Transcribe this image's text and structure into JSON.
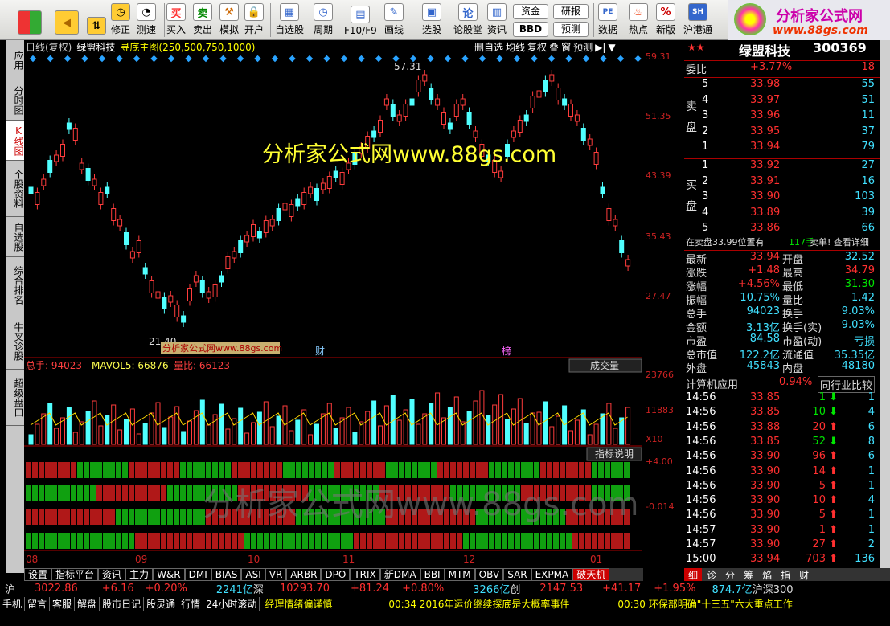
{
  "toolbar": {
    "items": [
      "修正",
      "测速",
      "买入",
      "卖出",
      "模拟",
      "开户",
      "自选股",
      "周期",
      "F10/F9",
      "画线",
      "选股",
      "论股堂",
      "资讯",
      "数据",
      "热点",
      "新版",
      "沪港通"
    ],
    "mini_top": [
      "资金",
      "研报"
    ],
    "mini_bottom": [
      "BBD",
      "预测"
    ],
    "icon_glyphs": {
      "buy": "买",
      "sell": "卖",
      "lun": "论",
      "pe": "PE",
      "sh": "SH"
    }
  },
  "logo": {
    "title": "分析家公式网",
    "url": "www.88gs.com"
  },
  "sidebar": [
    "应用",
    "分时图",
    "K线图",
    "个股资料",
    "自选股",
    "综合排名",
    "牛叉诊股",
    "超级盘口"
  ],
  "chart": {
    "period": "日线(复权)",
    "stock": "绿盟科技",
    "formula": "寻底主图(250,500,750,1000)",
    "menu": [
      "删自选",
      "均线",
      "复权",
      "叠",
      "窗",
      "预测"
    ],
    "watermark": "分析家公式网www.88gs.com",
    "watermark2": "分析家公式网www.88gs.com",
    "watermark_small": "分析家公式网www.88gs.com",
    "price_labels": [
      "59.31",
      "51.35",
      "43.39",
      "35.43",
      "27.47"
    ],
    "hi_label": "57.31",
    "lo_label": "21.40",
    "flag1": "财",
    "flag2": "榜",
    "vol_labels": [
      "23766",
      "11883",
      "X10"
    ],
    "ind_labels": [
      "+4.00",
      "-0.014"
    ],
    "vol_line": {
      "a": "总手: 94023",
      "b": "MAVOL5: 66876",
      "c": "量比: 66123"
    },
    "vol_sel": "成交量",
    "ind_title": "指标说明",
    "months": [
      "08",
      "09",
      "10",
      "11",
      "12",
      "01"
    ]
  },
  "panel": {
    "name": "绿盟科技",
    "code": "300369",
    "wb_label": "委比",
    "wb": "+3.77%",
    "wb_n": "18",
    "sell": [
      [
        "5",
        "33.98",
        "55"
      ],
      [
        "4",
        "33.97",
        "51"
      ],
      [
        "3",
        "33.96",
        "11"
      ],
      [
        "2",
        "33.95",
        "37"
      ],
      [
        "1",
        "33.94",
        "79"
      ]
    ],
    "buy": [
      [
        "1",
        "33.92",
        "27"
      ],
      [
        "2",
        "33.91",
        "16"
      ],
      [
        "3",
        "33.90",
        "103"
      ],
      [
        "4",
        "33.89",
        "39"
      ],
      [
        "5",
        "33.86",
        "66"
      ]
    ],
    "sell_tag": "卖盘",
    "buy_tag": "买盘",
    "notice": {
      "a": "在卖盘33.99位置有",
      "b": "117手",
      "c": "卖单! 查看详细"
    },
    "quote": [
      [
        "最新",
        "33.94",
        "开盘",
        "32.52"
      ],
      [
        "涨跌",
        "+1.48",
        "最高",
        "34.79"
      ],
      [
        "涨幅",
        "+4.56%",
        "最低",
        "31.30"
      ],
      [
        "振幅",
        "10.75%",
        "量比",
        "1.42"
      ],
      [
        "总手",
        "94023",
        "换手",
        "9.03%"
      ],
      [
        "金额",
        "3.13亿",
        "换手(实)",
        "9.03%"
      ],
      [
        "市盈",
        "84.58",
        "市盈(动)",
        "亏损"
      ],
      [
        "总市值",
        "122.2亿",
        "流通值",
        "35.35亿"
      ],
      [
        "外盘",
        "45843",
        "内盘",
        "48180"
      ]
    ],
    "sector": {
      "name": "计算机应用",
      "pct": "0.94%",
      "btn": "同行业比较"
    },
    "ticks": [
      [
        "14:56",
        "33.85",
        "1",
        "1"
      ],
      [
        "14:56",
        "33.85",
        "10",
        "4"
      ],
      [
        "14:56",
        "33.88",
        "20",
        "6"
      ],
      [
        "14:56",
        "33.85",
        "52",
        "8"
      ],
      [
        "14:56",
        "33.90",
        "96",
        "6"
      ],
      [
        "14:56",
        "33.90",
        "14",
        "1"
      ],
      [
        "14:56",
        "33.90",
        "5",
        "1"
      ],
      [
        "14:56",
        "33.90",
        "10",
        "4"
      ],
      [
        "14:56",
        "33.90",
        "5",
        "1"
      ],
      [
        "14:57",
        "33.90",
        "1",
        "1"
      ],
      [
        "14:57",
        "33.90",
        "27",
        "2"
      ],
      [
        "15:00",
        "33.94",
        "703",
        "136"
      ]
    ],
    "tabs": [
      "细",
      "诊",
      "分",
      "筹",
      "焰",
      "指",
      "财"
    ]
  },
  "bottom_tabs": [
    "设置",
    "指标平台",
    "资讯",
    "主力",
    "W&R",
    "DMI",
    "BIAS",
    "ASI",
    "VR",
    "ARBR",
    "DPO",
    "TRIX",
    "新DMA",
    "BBI",
    "MTM",
    "OBV",
    "SAR",
    "EXPMA",
    "破天机"
  ],
  "index": {
    "sh": "沪",
    "sh_v": "3022.86",
    "sh_c": "+6.16",
    "sh_p": "+0.20%",
    "sh_a": "2241亿",
    "sz": "深",
    "sz_v": "10293.70",
    "sz_c": "+81.24",
    "sz_p": "+0.80%",
    "sz_a": "3266亿",
    "cy": "创",
    "cy_v": "2147.53",
    "cy_c": "+41.17",
    "cy_p": "+1.95%",
    "cy_a": "874.7亿",
    "hs": "沪深300"
  },
  "status": {
    "items": [
      "手机",
      "留言",
      "客服",
      "解盘",
      "股市日记",
      "股灵通",
      "行情",
      "24小时滚动"
    ],
    "n1": "经理情绪偏谨慎",
    "n2": "00:34 2016年运价继续探底是大概率事件",
    "n3": "00:30 环保部明确\"十三五\"六大重点工作"
  }
}
